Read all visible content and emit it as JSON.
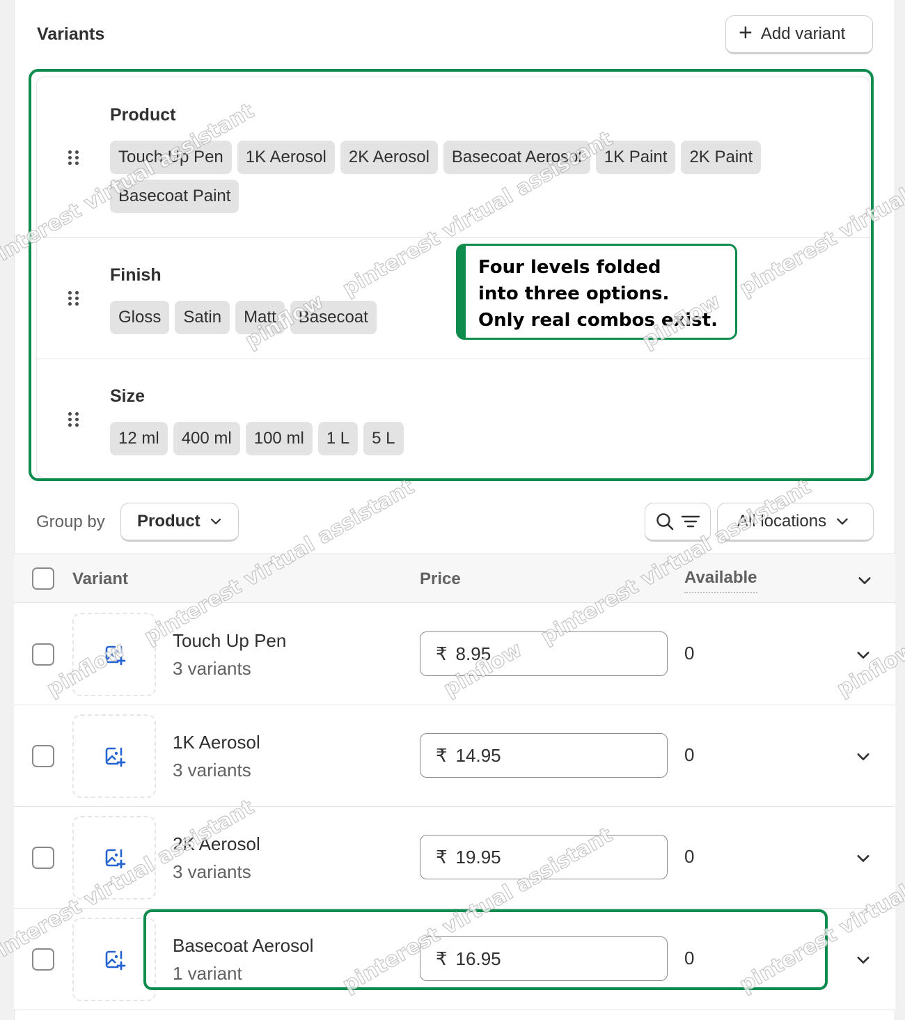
{
  "variants_card": {
    "title": "Variants",
    "add_variant_label": "Add variant"
  },
  "options": [
    {
      "name": "Product",
      "values": [
        "Touch Up Pen",
        "1K Aerosol",
        "2K Aerosol",
        "Basecoat Aerosol",
        "1K Paint",
        "2K Paint",
        "Basecoat Paint"
      ]
    },
    {
      "name": "Finish",
      "values": [
        "Gloss",
        "Satin",
        "Matt",
        "Basecoat"
      ]
    },
    {
      "name": "Size",
      "values": [
        "12 ml",
        "400 ml",
        "100 ml",
        "1 L",
        "5 L"
      ]
    }
  ],
  "callout": {
    "lines": [
      "Four levels folded",
      "into three options.",
      "Only real combos exist."
    ]
  },
  "toolbar": {
    "group_by_label": "Group by",
    "group_by_value": "Product",
    "locations_label": "All locations"
  },
  "table": {
    "headers": {
      "variant": "Variant",
      "price": "Price",
      "available": "Available"
    },
    "currency_symbol": "₹",
    "rows": [
      {
        "name": "Touch Up Pen",
        "sub": "3 variants",
        "price": "8.95",
        "available": "0"
      },
      {
        "name": "1K Aerosol",
        "sub": "3 variants",
        "price": "14.95",
        "available": "0"
      },
      {
        "name": "2K Aerosol",
        "sub": "3 variants",
        "price": "19.95",
        "available": "0"
      },
      {
        "name": "Basecoat Aerosol",
        "sub": "1 variant",
        "price": "16.95",
        "available": "0"
      }
    ]
  },
  "watermarks": [
    "pinterest virtual assistant",
    "pinflow"
  ],
  "colors": {
    "highlight": "#0e8c4e",
    "chip_bg": "#e3e3e3",
    "icon_blue": "#2463d1"
  }
}
